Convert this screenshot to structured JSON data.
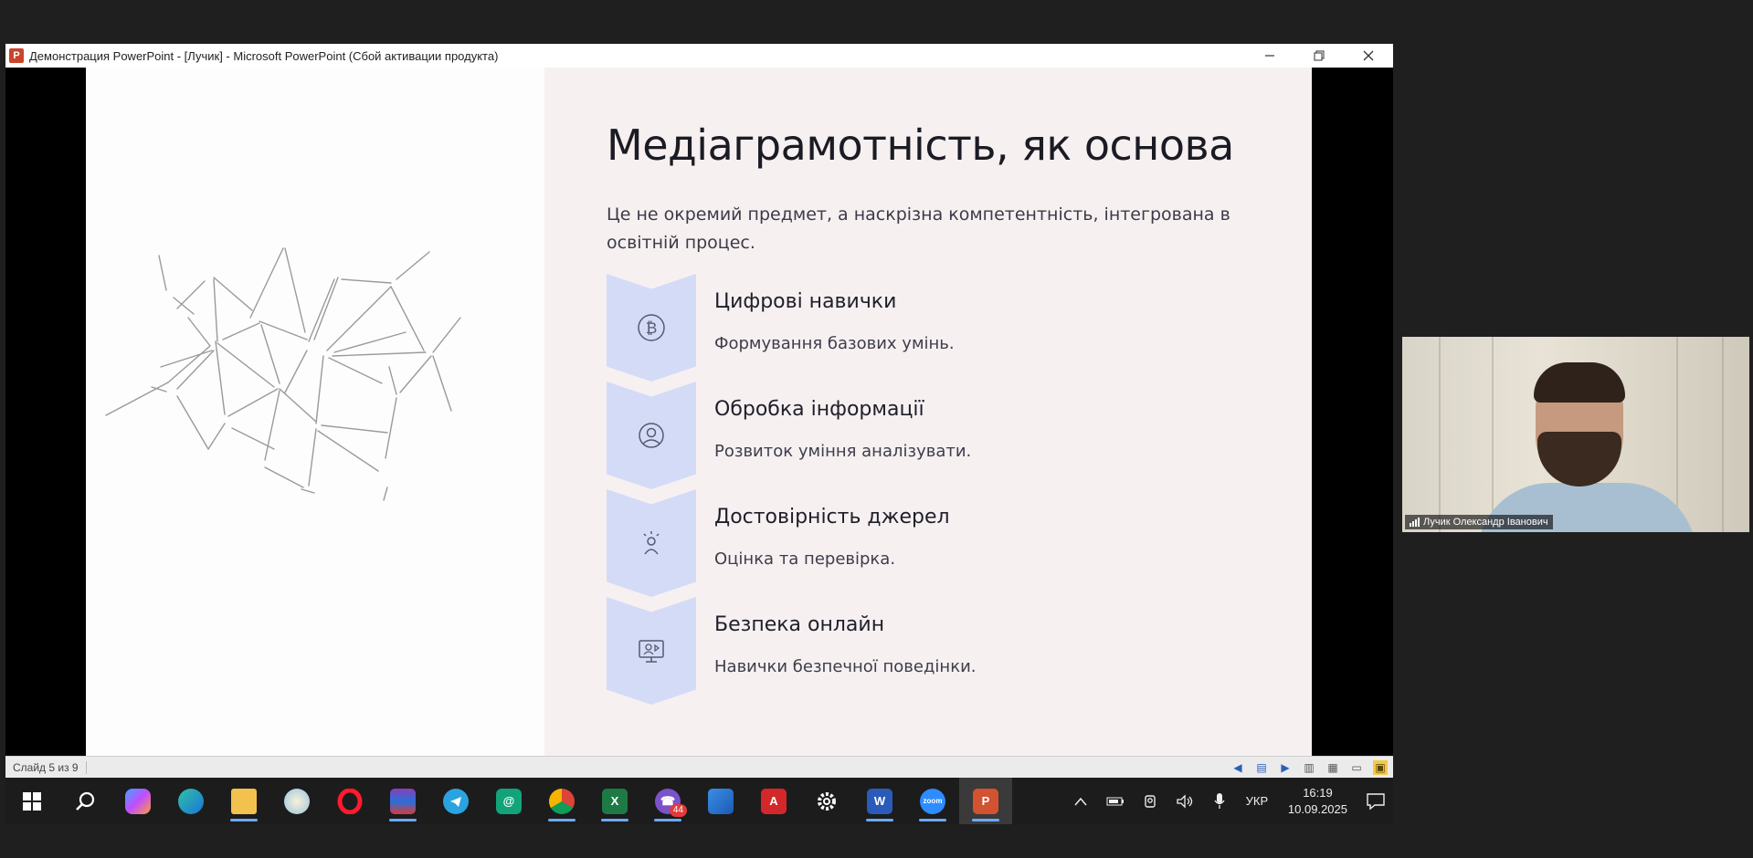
{
  "window": {
    "title": "Демонстрация PowerPoint - [Лучик] - Microsoft PowerPoint (Сбой активации продукта)",
    "app_icon_letter": "P"
  },
  "slide": {
    "title": "Медіаграмотність, як основа",
    "subtitle": "Це не окремий предмет, а наскрізна компетентність, інтегрована в освітній процес.",
    "features": [
      {
        "title": "Цифрові навички",
        "desc": "Формування базових умінь.",
        "icon": "bitcoin-icon"
      },
      {
        "title": "Обробка інформації",
        "desc": "Розвиток уміння аналізувати.",
        "icon": "user-circle-icon"
      },
      {
        "title": "Достовірність джерел",
        "desc": "Оцінка та перевірка.",
        "icon": "idea-person-icon"
      },
      {
        "title": "Безпека онлайн",
        "desc": "Навички безпечної поведінки.",
        "icon": "monitor-user-icon"
      }
    ]
  },
  "statusbar": {
    "slide_counter": "Слайд 5 из 9"
  },
  "taskbar": {
    "language": "УКР",
    "time": "16:19",
    "date": "10.09.2025",
    "viber_badge": "44",
    "zoom_label": "zoom"
  },
  "participant": {
    "name": "Лучик Олександр Іванович"
  },
  "colors": {
    "chevron": "#d4dbf7",
    "slide_right_bg": "#f7f0f1",
    "taskbar_bg": "#1c1c1c"
  }
}
